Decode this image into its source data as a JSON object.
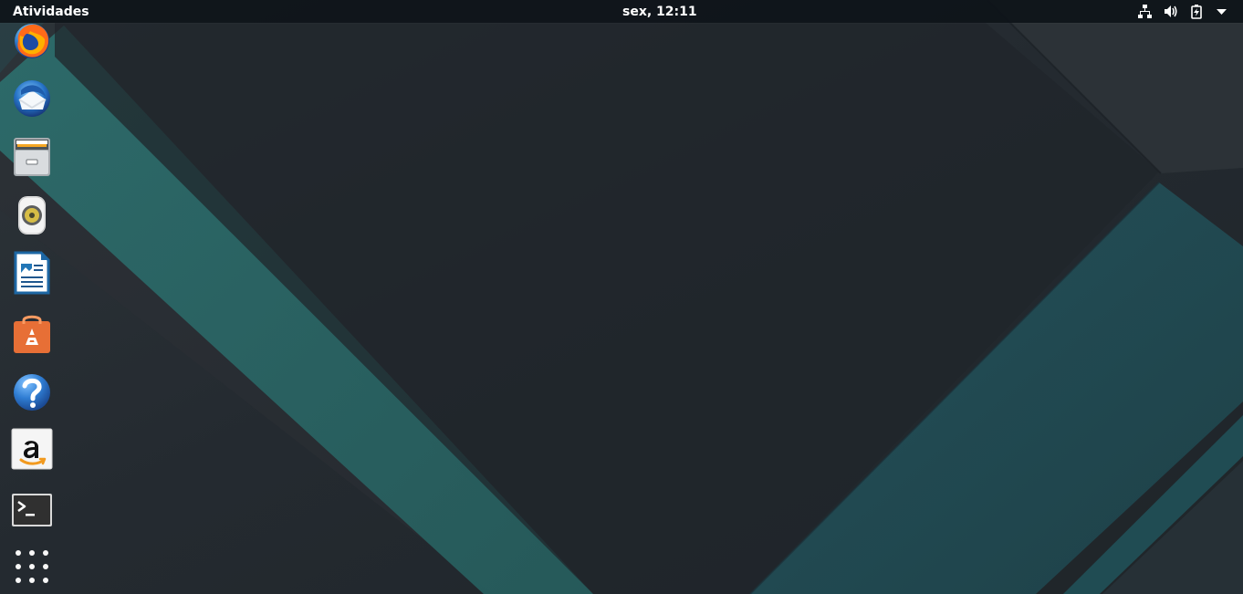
{
  "topbar": {
    "activities_label": "Atividades",
    "clock_text": "sex, 12:11"
  },
  "system_status": {
    "icons": [
      "network-wired-icon",
      "speaker-volume-icon",
      "battery-charging-icon",
      "menu-chevron-down-icon"
    ]
  },
  "dock": {
    "items": [
      {
        "icon": "firefox-icon"
      },
      {
        "icon": "thunderbird-icon"
      },
      {
        "icon": "files-cabinet-icon"
      },
      {
        "icon": "rhythmbox-speaker-icon"
      },
      {
        "icon": "libreoffice-writer-icon"
      },
      {
        "icon": "ubuntu-software-bag-icon"
      },
      {
        "icon": "help-question-icon"
      },
      {
        "icon": "amazon-icon"
      },
      {
        "icon": "terminal-icon"
      }
    ],
    "show_applications_icon": "app-grid-icon"
  },
  "colors": {
    "topbar_background": "#0d1318",
    "desktop_background": "#252b31",
    "teal_band": "#2c6a69",
    "blue_teal_band": "#1f454c"
  }
}
